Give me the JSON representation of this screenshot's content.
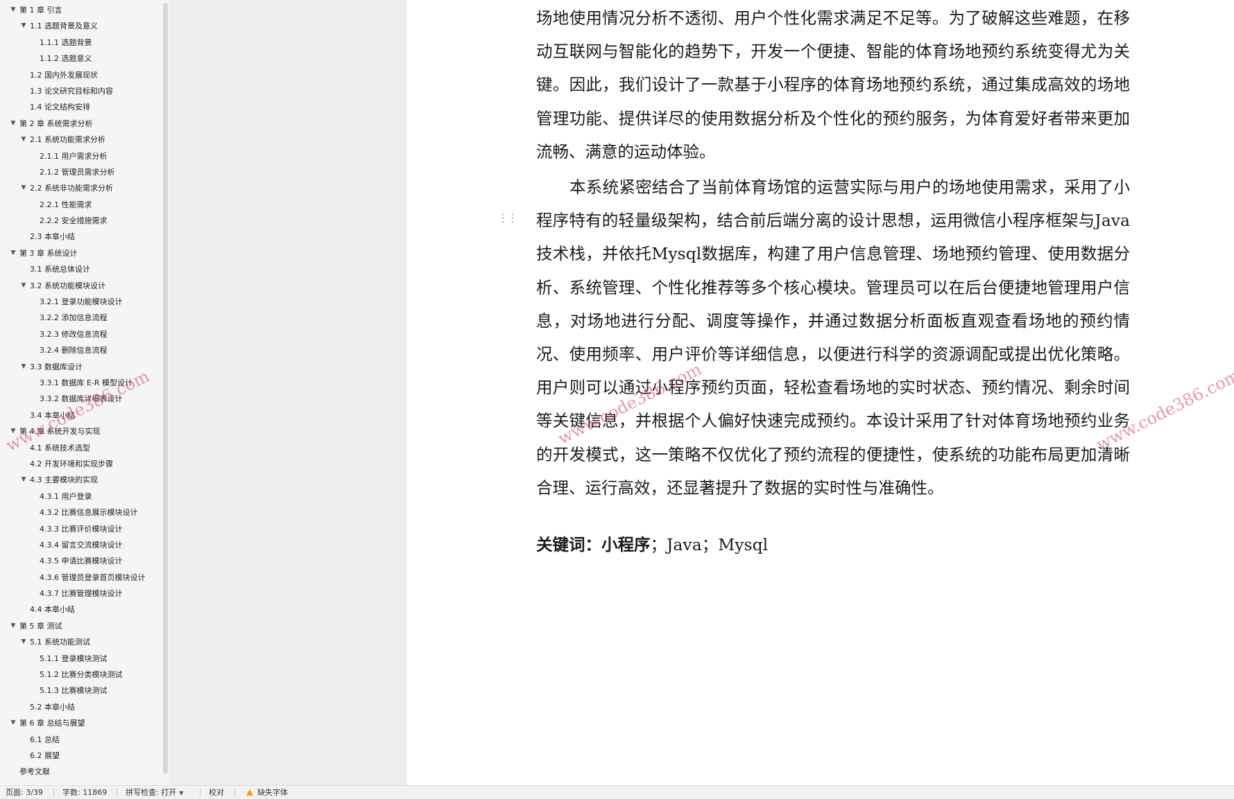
{
  "sidebar": {
    "toc": [
      {
        "level": 1,
        "expanded": true,
        "label": "第 1 章    引言"
      },
      {
        "level": 2,
        "expanded": true,
        "label": "1.1    选题背景及意义"
      },
      {
        "level": 3,
        "label": "1.1.1    选题背景"
      },
      {
        "level": 3,
        "label": "1.1.2    选题意义"
      },
      {
        "level": 2,
        "label": "1.2    国内外发展现状"
      },
      {
        "level": 2,
        "label": "1.3    论文研究目标和内容"
      },
      {
        "level": 2,
        "label": "1.4    论文结构安排"
      },
      {
        "level": 1,
        "expanded": true,
        "label": "第 2 章    系统需求分析"
      },
      {
        "level": 2,
        "expanded": true,
        "label": "2.1    系统功能需求分析"
      },
      {
        "level": 3,
        "label": "2.1.1    用户需求分析"
      },
      {
        "level": 3,
        "label": "2.1.2    管理员需求分析"
      },
      {
        "level": 2,
        "expanded": true,
        "label": "2.2    系统非功能需求分析"
      },
      {
        "level": 3,
        "label": "2.2.1 性能需求"
      },
      {
        "level": 3,
        "label": "2.2.2 安全措施需求"
      },
      {
        "level": 2,
        "label": "2.3    本章小结"
      },
      {
        "level": 1,
        "expanded": true,
        "label": "第 3 章  系统设计"
      },
      {
        "level": 2,
        "label": "3.1    系统总体设计"
      },
      {
        "level": 2,
        "expanded": true,
        "label": "3.2    系统功能模块设计"
      },
      {
        "level": 3,
        "label": "3.2.1    登录功能模块设计"
      },
      {
        "level": 3,
        "label": "3.2.2  添加信息流程"
      },
      {
        "level": 3,
        "label": "3.2.3  修改信息流程"
      },
      {
        "level": 3,
        "label": "3.2.4  删除信息流程"
      },
      {
        "level": 2,
        "expanded": true,
        "label": "3.3    数据库设计"
      },
      {
        "level": 3,
        "label": "3.3.1    数据库 E-R 模型设计"
      },
      {
        "level": 3,
        "label": "3.3.2    数据库详细表设计"
      },
      {
        "level": 2,
        "label": "3.4    本章小结"
      },
      {
        "level": 1,
        "expanded": true,
        "label": "第 4 章  系统开发与实现"
      },
      {
        "level": 2,
        "label": "4.1    系统技术选型"
      },
      {
        "level": 2,
        "label": "4.2    开发环境和实现步骤"
      },
      {
        "level": 2,
        "expanded": true,
        "label": "4.3    主要模块的实现"
      },
      {
        "level": 3,
        "label": "4.3.1    用户登录"
      },
      {
        "level": 3,
        "label": "4.3.2    比赛信息展示模块设计"
      },
      {
        "level": 3,
        "label": "4.3.3    比赛评价模块设计"
      },
      {
        "level": 3,
        "label": "4.3.4    留言交流模块设计"
      },
      {
        "level": 3,
        "label": "4.3.5    申请比赛模块设计"
      },
      {
        "level": 3,
        "label": "4.3.6    管理员登录首页模块设计"
      },
      {
        "level": 3,
        "label": "4.3.7    比赛管理模块设计"
      },
      {
        "level": 2,
        "label": "4.4    本章小结"
      },
      {
        "level": 1,
        "expanded": true,
        "label": "第 5 章    测试"
      },
      {
        "level": 2,
        "expanded": true,
        "label": "5.1    系统功能测试"
      },
      {
        "level": 3,
        "label": "5.1.1    登录模块测试"
      },
      {
        "level": 3,
        "label": "5.1.2    比赛分类模块测试"
      },
      {
        "level": 3,
        "label": "5.1.3    比赛模块测试"
      },
      {
        "level": 2,
        "label": "5.2    本章小结"
      },
      {
        "level": 1,
        "expanded": true,
        "label": "第 6 章    总结与展望"
      },
      {
        "level": 2,
        "label": "6.1    总结"
      },
      {
        "level": 2,
        "label": "6.2    展望"
      },
      {
        "level": 1,
        "label": "参考文献"
      }
    ]
  },
  "document": {
    "paragraph_1": "场地使用情况分析不透彻、用户个性化需求满足不足等。为了破解这些难题，在移动互联网与智能化的趋势下，开发一个便捷、智能的体育场地预约系统变得尤为关键。因此，我们设计了一款基于小程序的体育场地预约系统，通过集成高效的场地管理功能、提供详尽的使用数据分析及个性化的预约服务，为体育爱好者带来更加流畅、满意的运动体验。",
    "paragraph_2": "本系统紧密结合了当前体育场馆的运营实际与用户的场地使用需求，采用了小程序特有的轻量级架构，结合前后端分离的设计思想，运用微信小程序框架与Java技术栈，并依托Mysql数据库，构建了用户信息管理、场地预约管理、使用数据分析、系统管理、个性化推荐等多个核心模块。管理员可以在后台便捷地管理用户信息，对场地进行分配、调度等操作，并通过数据分析面板直观查看场地的预约情况、使用频率、用户评价等详细信息，以便进行科学的资源调配或提出优化策略。用户则可以通过小程序预约页面，轻松查看场地的实时状态、预约情况、剩余时间等关键信息，并根据个人偏好快速完成预约。本设计采用了针对体育场地预约业务的开发模式，这一策略不仅优化了预约流程的便捷性，使系统的功能布局更加清晰合理、运行高效，还显著提升了数据的实时性与准确性。",
    "keywords_label": "关键词：",
    "keywords_bold": "小程序",
    "keywords_rest": "；Java；Mysql",
    "drag_handle": "⋮⋮"
  },
  "watermarks": [
    "www.code386.com",
    "www.code386.com",
    "www.code386.com"
  ],
  "statusbar": {
    "page": "页面: 3/39",
    "words": "字数: 11869",
    "spellcheck": "拼写检查: 打开",
    "proofread": "校对",
    "missing_font": "缺失字体"
  },
  "colors": {
    "sidebar_bg": "#f5f5f5",
    "canvas_bg": "#eeeeee",
    "watermark": "#cd466e",
    "warning": "#f0a000"
  }
}
